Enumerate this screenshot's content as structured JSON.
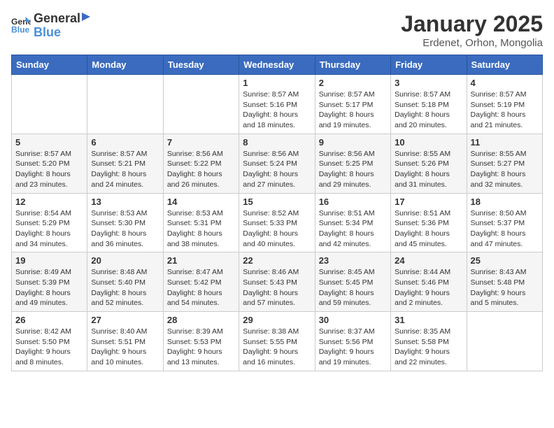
{
  "logo": {
    "general": "General",
    "blue": "Blue"
  },
  "header": {
    "title": "January 2025",
    "subtitle": "Erdenet, Orhon, Mongolia"
  },
  "weekdays": [
    "Sunday",
    "Monday",
    "Tuesday",
    "Wednesday",
    "Thursday",
    "Friday",
    "Saturday"
  ],
  "weeks": [
    [
      {
        "day": "",
        "sunrise": "",
        "sunset": "",
        "daylight": ""
      },
      {
        "day": "",
        "sunrise": "",
        "sunset": "",
        "daylight": ""
      },
      {
        "day": "",
        "sunrise": "",
        "sunset": "",
        "daylight": ""
      },
      {
        "day": "1",
        "sunrise": "Sunrise: 8:57 AM",
        "sunset": "Sunset: 5:16 PM",
        "daylight": "Daylight: 8 hours and 18 minutes."
      },
      {
        "day": "2",
        "sunrise": "Sunrise: 8:57 AM",
        "sunset": "Sunset: 5:17 PM",
        "daylight": "Daylight: 8 hours and 19 minutes."
      },
      {
        "day": "3",
        "sunrise": "Sunrise: 8:57 AM",
        "sunset": "Sunset: 5:18 PM",
        "daylight": "Daylight: 8 hours and 20 minutes."
      },
      {
        "day": "4",
        "sunrise": "Sunrise: 8:57 AM",
        "sunset": "Sunset: 5:19 PM",
        "daylight": "Daylight: 8 hours and 21 minutes."
      }
    ],
    [
      {
        "day": "5",
        "sunrise": "Sunrise: 8:57 AM",
        "sunset": "Sunset: 5:20 PM",
        "daylight": "Daylight: 8 hours and 23 minutes."
      },
      {
        "day": "6",
        "sunrise": "Sunrise: 8:57 AM",
        "sunset": "Sunset: 5:21 PM",
        "daylight": "Daylight: 8 hours and 24 minutes."
      },
      {
        "day": "7",
        "sunrise": "Sunrise: 8:56 AM",
        "sunset": "Sunset: 5:22 PM",
        "daylight": "Daylight: 8 hours and 26 minutes."
      },
      {
        "day": "8",
        "sunrise": "Sunrise: 8:56 AM",
        "sunset": "Sunset: 5:24 PM",
        "daylight": "Daylight: 8 hours and 27 minutes."
      },
      {
        "day": "9",
        "sunrise": "Sunrise: 8:56 AM",
        "sunset": "Sunset: 5:25 PM",
        "daylight": "Daylight: 8 hours and 29 minutes."
      },
      {
        "day": "10",
        "sunrise": "Sunrise: 8:55 AM",
        "sunset": "Sunset: 5:26 PM",
        "daylight": "Daylight: 8 hours and 31 minutes."
      },
      {
        "day": "11",
        "sunrise": "Sunrise: 8:55 AM",
        "sunset": "Sunset: 5:27 PM",
        "daylight": "Daylight: 8 hours and 32 minutes."
      }
    ],
    [
      {
        "day": "12",
        "sunrise": "Sunrise: 8:54 AM",
        "sunset": "Sunset: 5:29 PM",
        "daylight": "Daylight: 8 hours and 34 minutes."
      },
      {
        "day": "13",
        "sunrise": "Sunrise: 8:53 AM",
        "sunset": "Sunset: 5:30 PM",
        "daylight": "Daylight: 8 hours and 36 minutes."
      },
      {
        "day": "14",
        "sunrise": "Sunrise: 8:53 AM",
        "sunset": "Sunset: 5:31 PM",
        "daylight": "Daylight: 8 hours and 38 minutes."
      },
      {
        "day": "15",
        "sunrise": "Sunrise: 8:52 AM",
        "sunset": "Sunset: 5:33 PM",
        "daylight": "Daylight: 8 hours and 40 minutes."
      },
      {
        "day": "16",
        "sunrise": "Sunrise: 8:51 AM",
        "sunset": "Sunset: 5:34 PM",
        "daylight": "Daylight: 8 hours and 42 minutes."
      },
      {
        "day": "17",
        "sunrise": "Sunrise: 8:51 AM",
        "sunset": "Sunset: 5:36 PM",
        "daylight": "Daylight: 8 hours and 45 minutes."
      },
      {
        "day": "18",
        "sunrise": "Sunrise: 8:50 AM",
        "sunset": "Sunset: 5:37 PM",
        "daylight": "Daylight: 8 hours and 47 minutes."
      }
    ],
    [
      {
        "day": "19",
        "sunrise": "Sunrise: 8:49 AM",
        "sunset": "Sunset: 5:39 PM",
        "daylight": "Daylight: 8 hours and 49 minutes."
      },
      {
        "day": "20",
        "sunrise": "Sunrise: 8:48 AM",
        "sunset": "Sunset: 5:40 PM",
        "daylight": "Daylight: 8 hours and 52 minutes."
      },
      {
        "day": "21",
        "sunrise": "Sunrise: 8:47 AM",
        "sunset": "Sunset: 5:42 PM",
        "daylight": "Daylight: 8 hours and 54 minutes."
      },
      {
        "day": "22",
        "sunrise": "Sunrise: 8:46 AM",
        "sunset": "Sunset: 5:43 PM",
        "daylight": "Daylight: 8 hours and 57 minutes."
      },
      {
        "day": "23",
        "sunrise": "Sunrise: 8:45 AM",
        "sunset": "Sunset: 5:45 PM",
        "daylight": "Daylight: 8 hours and 59 minutes."
      },
      {
        "day": "24",
        "sunrise": "Sunrise: 8:44 AM",
        "sunset": "Sunset: 5:46 PM",
        "daylight": "Daylight: 9 hours and 2 minutes."
      },
      {
        "day": "25",
        "sunrise": "Sunrise: 8:43 AM",
        "sunset": "Sunset: 5:48 PM",
        "daylight": "Daylight: 9 hours and 5 minutes."
      }
    ],
    [
      {
        "day": "26",
        "sunrise": "Sunrise: 8:42 AM",
        "sunset": "Sunset: 5:50 PM",
        "daylight": "Daylight: 9 hours and 8 minutes."
      },
      {
        "day": "27",
        "sunrise": "Sunrise: 8:40 AM",
        "sunset": "Sunset: 5:51 PM",
        "daylight": "Daylight: 9 hours and 10 minutes."
      },
      {
        "day": "28",
        "sunrise": "Sunrise: 8:39 AM",
        "sunset": "Sunset: 5:53 PM",
        "daylight": "Daylight: 9 hours and 13 minutes."
      },
      {
        "day": "29",
        "sunrise": "Sunrise: 8:38 AM",
        "sunset": "Sunset: 5:55 PM",
        "daylight": "Daylight: 9 hours and 16 minutes."
      },
      {
        "day": "30",
        "sunrise": "Sunrise: 8:37 AM",
        "sunset": "Sunset: 5:56 PM",
        "daylight": "Daylight: 9 hours and 19 minutes."
      },
      {
        "day": "31",
        "sunrise": "Sunrise: 8:35 AM",
        "sunset": "Sunset: 5:58 PM",
        "daylight": "Daylight: 9 hours and 22 minutes."
      },
      {
        "day": "",
        "sunrise": "",
        "sunset": "",
        "daylight": ""
      }
    ]
  ]
}
